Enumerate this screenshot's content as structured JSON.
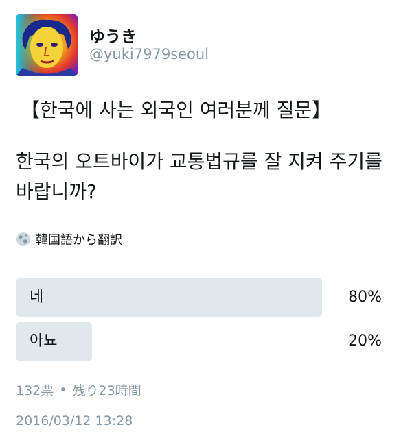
{
  "user": {
    "display_name": "ゆうき",
    "handle": "@yuki7979seoul"
  },
  "tweet": {
    "title_line": "【한국에 사는 외국인 여러분께 질문】",
    "body": "한국의 오트바이가 교통법규를 잘 지켜 주기를 바랍니까?",
    "translate_label": "韓国語から翻訳",
    "translate_icon": "globe-icon"
  },
  "poll": {
    "options": [
      {
        "label": "네",
        "percent_label": "80%",
        "percent": 80
      },
      {
        "label": "아뇨",
        "percent_label": "20%",
        "percent": 20
      }
    ],
    "votes": "132票",
    "separator": "•",
    "time_left": "残り23時間"
  },
  "timestamp": "2016/03/12 13:28",
  "colors": {
    "bar": "#e1e8ed",
    "muted": "#8899a6",
    "text": "#14171a"
  }
}
